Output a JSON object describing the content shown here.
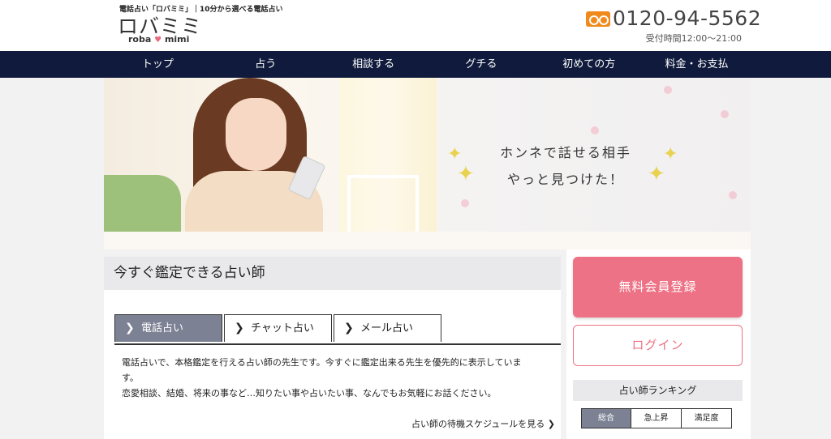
{
  "header": {
    "tagline": "電話占い「ロバミミ」｜10分から選べる電話占い",
    "logo_jp": "ロバミミ",
    "logo_en_left": "roba",
    "logo_en_right": "mimi",
    "phone": "0120-94-5562",
    "hours": "受付時間12:00～21:00"
  },
  "nav": {
    "items": [
      "トップ",
      "占う",
      "相談する",
      "グチる",
      "初めての方",
      "料金・お支払"
    ]
  },
  "hero": {
    "line1": "ホンネで話せる相手",
    "line2": "やっと見つけた！"
  },
  "main": {
    "section_title": "今すぐ鑑定できる占い師",
    "tabs": [
      {
        "label": "電話占い",
        "active": true
      },
      {
        "label": "チャット占い",
        "active": false
      },
      {
        "label": "メール占い",
        "active": false
      }
    ],
    "desc_line1": "電話占いで、本格鑑定を行える占い師の先生です。今すぐに鑑定出来る先生を優先的に表示していま",
    "desc_line2": "す。",
    "desc_line3": "恋愛相談、結婚、将来の事など…知りたい事や占いたい事、なんでもお気軽にお話ください。",
    "schedule_link": "占い師の待機スケジュールを見る"
  },
  "sidebar": {
    "register_label": "無料会員登録",
    "login_label": "ログイン",
    "ranking_title": "占い師ランキング",
    "ranking_tabs": [
      {
        "label": "総合",
        "active": true
      },
      {
        "label": "急上昇",
        "active": false
      },
      {
        "label": "満足度",
        "active": false
      }
    ]
  },
  "colors": {
    "nav_bg": "#0f1a3c",
    "accent_pink": "#ee7285",
    "tab_active": "#7c8193",
    "phone_icon": "#f08a1c"
  }
}
